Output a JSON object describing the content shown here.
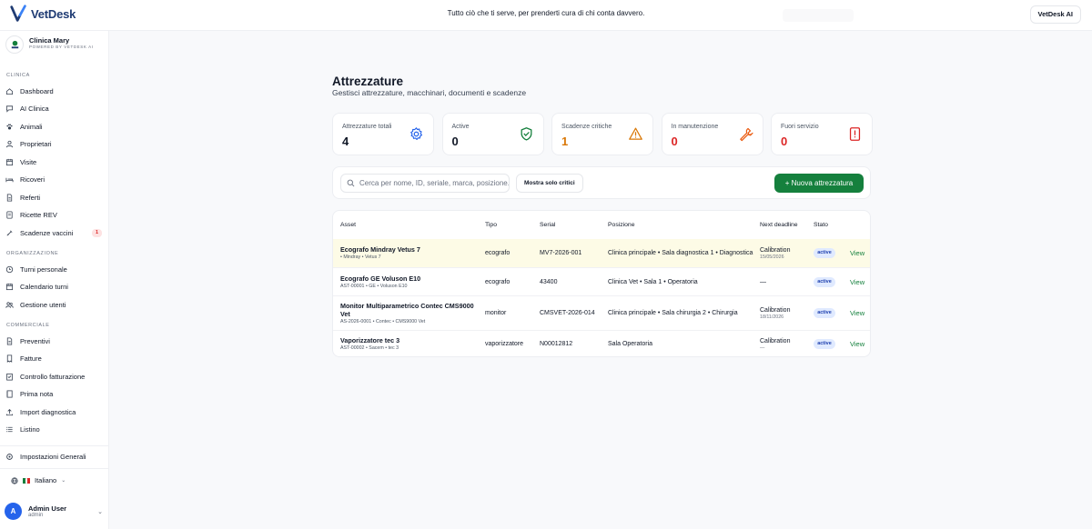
{
  "brand": {
    "name": "VetDesk",
    "accent": "#1f3b73"
  },
  "topbar": {
    "tagline": "Tutto ciò che ti serve, per prenderti cura di chi conta davvero.",
    "right_button": "VetDesk AI"
  },
  "clinic": {
    "name": "Clinica Mary",
    "subtitle": "POWERED BY VETDESK AI"
  },
  "sidebar": {
    "section_clinica": "CLINICA",
    "clinica_items": [
      {
        "label": "Dashboard",
        "icon": "home-icon"
      },
      {
        "label": "AI Clinica",
        "icon": "chat-icon"
      },
      {
        "label": "Animali",
        "icon": "paw-icon"
      },
      {
        "label": "Proprietari",
        "icon": "user-icon"
      },
      {
        "label": "Visite",
        "icon": "calendar-icon"
      },
      {
        "label": "Ricoveri",
        "icon": "bed-icon"
      },
      {
        "label": "Referti",
        "icon": "document-icon"
      },
      {
        "label": "Ricette REV",
        "icon": "prescription-icon"
      },
      {
        "label": "Scadenze vaccini",
        "icon": "syringe-icon",
        "badge": "1"
      }
    ],
    "section_organizzazione": "ORGANIZZAZIONE",
    "org_items": [
      {
        "label": "Turni personale",
        "icon": "clock-icon"
      },
      {
        "label": "Calendario turni",
        "icon": "calendar-icon"
      },
      {
        "label": "Gestione utenti",
        "icon": "users-icon"
      }
    ],
    "section_commerciale": "COMMERCIALE",
    "comm_items": [
      {
        "label": "Preventivi",
        "icon": "document-icon"
      },
      {
        "label": "Fatture",
        "icon": "receipt-icon"
      },
      {
        "label": "Controllo fatturazione",
        "icon": "checklist-icon"
      },
      {
        "label": "Prima nota",
        "icon": "notebook-icon"
      },
      {
        "label": "Import diagnostica",
        "icon": "upload-icon"
      },
      {
        "label": "Listino",
        "icon": "list-icon"
      }
    ],
    "settings": "Impostazioni Generali",
    "language": "Italiano",
    "user": {
      "initial": "A",
      "name": "Admin User",
      "role": "admin"
    }
  },
  "page": {
    "title": "Attrezzature",
    "subtitle": "Gestisci attrezzature, macchinari, documenti e scadenze"
  },
  "stats": [
    {
      "label": "Attrezzature totali",
      "value": "4",
      "color": "#111827",
      "icon": "gear-icon",
      "icon_color": "#2563eb"
    },
    {
      "label": "Active",
      "value": "0",
      "color": "#111827",
      "icon": "shield-check-icon",
      "icon_color": "#15803d"
    },
    {
      "label": "Scadenze critiche",
      "value": "1",
      "color": "#d97706",
      "icon": "warning-icon",
      "icon_color": "#d97706"
    },
    {
      "label": "In manutenzione",
      "value": "0",
      "color": "#dc2626",
      "icon": "wrench-icon",
      "icon_color": "#ea580c"
    },
    {
      "label": "Fuori servizio",
      "value": "0",
      "color": "#dc2626",
      "icon": "alert-file-icon",
      "icon_color": "#dc2626"
    }
  ],
  "toolbar": {
    "search_placeholder": "Cerca per nome, ID, seriale, marca, posizione...",
    "critical_button": "Mostra solo critici",
    "new_button": "+ Nuova attrezzatura"
  },
  "table": {
    "headers": {
      "asset": "Asset",
      "tipo": "Tipo",
      "serial": "Serial",
      "posizione": "Posizione",
      "deadline": "Next deadline",
      "stato": "Stato"
    },
    "rows": [
      {
        "name": "Ecografo Mindray Vetus 7",
        "sub": "• Mindray • Vetus 7",
        "tipo": "ecografo",
        "serial": "MV7-2026-001",
        "posizione": "Clinica principale • Sala diagnostica 1 • Diagnostica",
        "deadline": "Calibration",
        "deadline_date": "15/05/2026",
        "stato": "active",
        "action": "View"
      },
      {
        "name": "Ecografo GE Voluson E10",
        "sub": "AST-00001 • GE • Voluson E10",
        "tipo": "ecografo",
        "serial": "43400",
        "posizione": "Clinica Vet • Sala 1 • Operatoria",
        "deadline": "—",
        "deadline_date": "",
        "stato": "active",
        "action": "View"
      },
      {
        "name": "Monitor Multiparametrico Contec CMS9000 Vet",
        "sub": "AS-2026-0001 • Contec • CMS9000 Vet",
        "tipo": "monitor",
        "serial": "CMSVET-2026-014",
        "posizione": "Clinica principale • Sala chirurgia 2 • Chirurgia",
        "deadline": "Calibration",
        "deadline_date": "18/11/2026",
        "stato": "active",
        "action": "View"
      },
      {
        "name": "Vaporizzatore tec 3",
        "sub": "AST-00002 • Sacem • tec 3",
        "tipo": "vaporizzatore",
        "serial": "N00012812",
        "posizione": "Sala Operatoria",
        "deadline": "Calibration",
        "deadline_date": "—",
        "stato": "active",
        "action": "View"
      }
    ]
  }
}
